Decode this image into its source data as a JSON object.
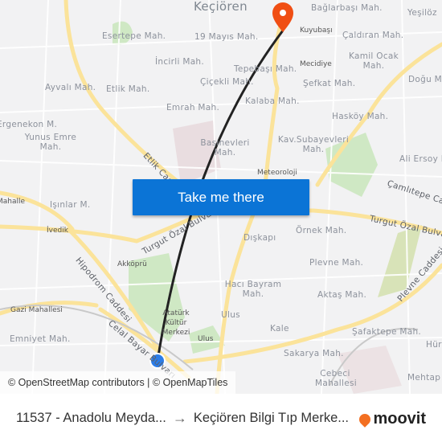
{
  "map": {
    "labels": [
      "Keçiören",
      "Bağlarbaşı Mah.",
      "Yeşilöz",
      "Esertepe Mah.",
      "19 Mayıs Mah.",
      "Kuyubaşı",
      "Çaldıran Mah.",
      "İncirli Mah.",
      "Kamil Ocak Mah.",
      "Mecidiye",
      "Tepebaşı Mah.",
      "Ayvalı Mah.",
      "Etlik Mah.",
      "Çiçekli Mah.",
      "Şefkat Mah.",
      "Doğu Mah.",
      "Kalaba Mah.",
      "Emrah Mah.",
      "Hasköy Mah.",
      "Ergenekon M.",
      "Yunus Emre Mah.",
      "Basınevleri Mah.",
      "Kav.Subayevleri Mah.",
      "Ali Ersoy M.",
      "Meteoroloji",
      "Işınlar M.",
      "İvedik",
      "Dışkapı",
      "Örnek Mah.",
      "Akköprü",
      "Plevne Mah.",
      "Hacı Bayram Mah.",
      "Aktaş Mah.",
      "Gazi Mahallesi",
      "Atatürk Kültür Merkezi",
      "Ulus",
      "Kale",
      "Şafaktepe Mah.",
      "Emniyet Mah.",
      "Ulus",
      "Sakarya Mah.",
      "Cebeci Mahallesi",
      "Mehtap",
      "Mahalle",
      "Hür"
    ],
    "roads": [
      "Etlik Caddesi",
      "Turgut Özal Bulvarı",
      "Turgut Özal Bulvarı",
      "Hipodrom Caddesi",
      "Celal Bayar Bulvarı",
      "Plevne Caddesi",
      "Çamlıtepe Caddesi"
    ],
    "attribution": "© OpenStreetMap contributors | © OpenMapTiles",
    "route_color": "#222222",
    "origin_marker_color": "#2b7de9",
    "destination_marker_color": "#f04e13"
  },
  "cta": {
    "label": "Take me there",
    "color": "#0b74d6"
  },
  "footer": {
    "from": "11537 - Anadolu Meyda...",
    "arrow": "→",
    "to": "Keçiören Bilgi Tıp Merke...",
    "brand": "moovit"
  }
}
